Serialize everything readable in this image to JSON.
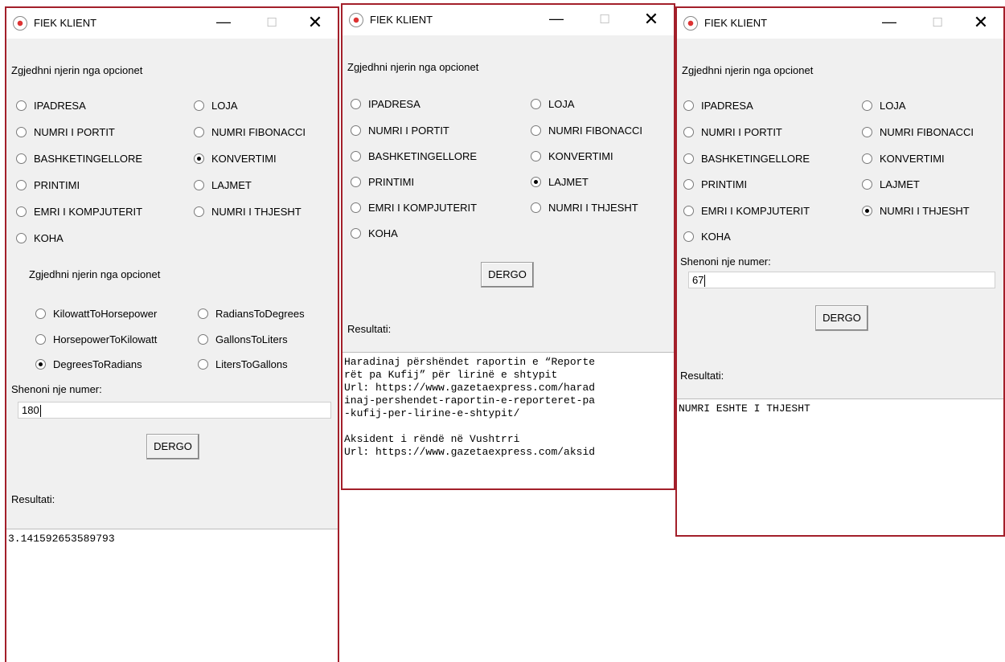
{
  "windows": [
    {
      "title": "FIEK KLIENT",
      "controls": {
        "minimize": "—",
        "maximize": "☐",
        "close": "✕"
      },
      "prompt1": "Zgjedhni njerin nga opcionet",
      "options": [
        {
          "label": "IPADRESA",
          "checked": false
        },
        {
          "label": "LOJA",
          "checked": false
        },
        {
          "label": "NUMRI I PORTIT",
          "checked": false
        },
        {
          "label": "NUMRI FIBONACCI",
          "checked": false
        },
        {
          "label": "BASHKETINGELLORE",
          "checked": false
        },
        {
          "label": "KONVERTIMI",
          "checked": true
        },
        {
          "label": "PRINTIMI",
          "checked": false
        },
        {
          "label": "LAJMET",
          "checked": false
        },
        {
          "label": "EMRI I KOMPJUTERIT",
          "checked": false
        },
        {
          "label": "NUMRI I THJESHT",
          "checked": false
        },
        {
          "label": "KOHA",
          "checked": false
        }
      ],
      "prompt2": "Zgjedhni njerin nga opcionet",
      "conversions": [
        {
          "label": "KilowattToHorsepower",
          "checked": false
        },
        {
          "label": "RadiansToDegrees",
          "checked": false
        },
        {
          "label": "HorsepowerToKilowatt",
          "checked": false
        },
        {
          "label": "GallonsToLiters",
          "checked": false
        },
        {
          "label": "DegreesToRadians",
          "checked": true
        },
        {
          "label": "LitersToGallons",
          "checked": false
        }
      ],
      "input_label": "Shenoni nje numer:",
      "input_value": "180",
      "button": "DERGO",
      "result_label": "Resultati:",
      "result_text": "3.141592653589793"
    },
    {
      "title": "FIEK KLIENT",
      "controls": {
        "minimize": "—",
        "maximize": "☐",
        "close": "✕"
      },
      "prompt1": "Zgjedhni njerin nga opcionet",
      "options": [
        {
          "label": "IPADRESA",
          "checked": false
        },
        {
          "label": "LOJA",
          "checked": false
        },
        {
          "label": "NUMRI I PORTIT",
          "checked": false
        },
        {
          "label": "NUMRI FIBONACCI",
          "checked": false
        },
        {
          "label": "BASHKETINGELLORE",
          "checked": false
        },
        {
          "label": "KONVERTIMI",
          "checked": false
        },
        {
          "label": "PRINTIMI",
          "checked": false
        },
        {
          "label": "LAJMET",
          "checked": true
        },
        {
          "label": "EMRI I KOMPJUTERIT",
          "checked": false
        },
        {
          "label": "NUMRI I THJESHT",
          "checked": false
        },
        {
          "label": "KOHA",
          "checked": false
        }
      ],
      "button": "DERGO",
      "result_label": "Resultati:",
      "result_text": "Haradinaj përshëndet raportin e “Reporte\nrët pa Kufij” për lirinë e shtypit\nUrl: https://www.gazetaexpress.com/harad\ninaj-pershendet-raportin-e-reporteret-pa\n-kufij-per-lirine-e-shtypit/\n\nAksident i rëndë në Vushtrri\nUrl: https://www.gazetaexpress.com/aksid"
    },
    {
      "title": "FIEK KLIENT",
      "controls": {
        "minimize": "—",
        "maximize": "☐",
        "close": "✕"
      },
      "prompt1": "Zgjedhni njerin nga opcionet",
      "options": [
        {
          "label": "IPADRESA",
          "checked": false
        },
        {
          "label": "LOJA",
          "checked": false
        },
        {
          "label": "NUMRI I PORTIT",
          "checked": false
        },
        {
          "label": "NUMRI FIBONACCI",
          "checked": false
        },
        {
          "label": "BASHKETINGELLORE",
          "checked": false
        },
        {
          "label": "KONVERTIMI",
          "checked": false
        },
        {
          "label": "PRINTIMI",
          "checked": false
        },
        {
          "label": "LAJMET",
          "checked": false
        },
        {
          "label": "EMRI I KOMPJUTERIT",
          "checked": false
        },
        {
          "label": "NUMRI I THJESHT",
          "checked": true
        },
        {
          "label": "KOHA",
          "checked": false
        }
      ],
      "input_label": "Shenoni nje numer:",
      "input_value": "67",
      "button": "DERGO",
      "result_label": "Resultati:",
      "result_text": "NUMRI ESHTE I THJESHT"
    }
  ],
  "colors": {
    "window_border": "#a31f2a",
    "client_bg": "#f0f0f0",
    "titlebar_bg": "#ffffff"
  }
}
